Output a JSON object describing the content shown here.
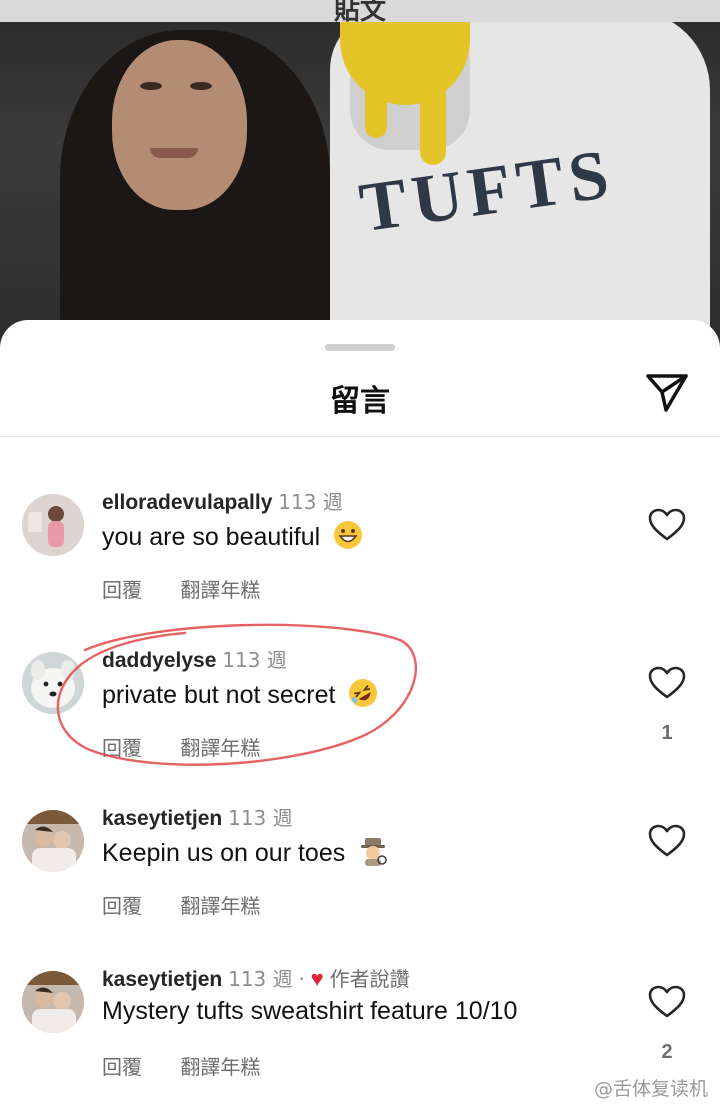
{
  "photo": {
    "header_text": "貼文",
    "sweatshirt_text": "TUFTS"
  },
  "sheet": {
    "title": "留言",
    "share_icon": "paper-plane-icon"
  },
  "comments": [
    {
      "username": "elloradevulapally",
      "age": "113 週",
      "text": "you are so beautiful",
      "emoji": "grinning-face-emoji",
      "reply_label": "回覆",
      "translate_label": "翻譯年糕",
      "likes": ""
    },
    {
      "username": "daddyelyse",
      "age": "113 週",
      "text": "private but not secret",
      "emoji": "rolling-on-floor-laughing-emoji",
      "reply_label": "回覆",
      "translate_label": "翻譯年糕",
      "likes": "1"
    },
    {
      "username": "kaseytietjen",
      "age": "113 週",
      "text": "Keepin us on our toes",
      "emoji": "detective-emoji",
      "reply_label": "回覆",
      "translate_label": "翻譯年糕",
      "likes": ""
    },
    {
      "username": "kaseytietjen",
      "age": "113 週",
      "separator": "·",
      "author_badge": "作者說讚",
      "text": "Mystery tufts sweatshirt feature 10/10",
      "reply_label": "回覆",
      "translate_label": "翻譯年糕",
      "likes": "2"
    }
  ],
  "watermark": "@舌体复读机",
  "colors": {
    "annotation_circle": "#e0484a",
    "heart_badge": "#e0243b",
    "text_primary": "#111111",
    "text_secondary": "#8e8e8e"
  }
}
